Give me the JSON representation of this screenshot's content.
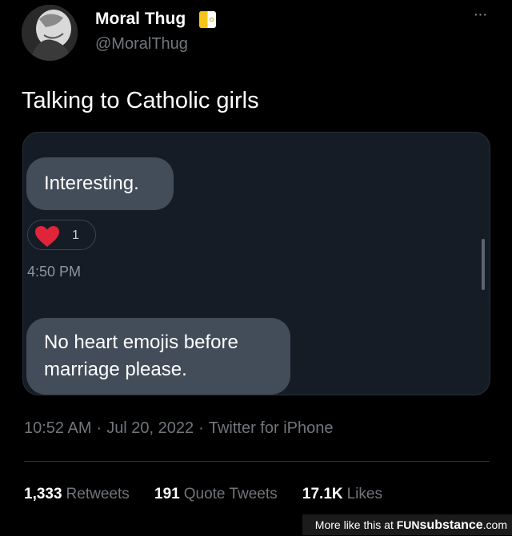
{
  "author": {
    "display_name": "Moral Thug",
    "handle": "@MoralThug",
    "badge_icon": "vatican-flag-icon",
    "avatar_icon": "avatar-image"
  },
  "more_label": "···",
  "tweet": {
    "text": "Talking to Catholic girls"
  },
  "media": {
    "bubble_1": "Interesting.",
    "reaction": {
      "icon": "red-heart-icon",
      "count": "1"
    },
    "time": "4:50 PM",
    "bubble_2_line_1": "No heart emojis before",
    "bubble_2_line_2": "marriage please."
  },
  "meta": {
    "time": "10:52 AM",
    "sep_1": "·",
    "date": "Jul 20, 2022",
    "sep_2": "·",
    "source": "Twitter for iPhone"
  },
  "stats": {
    "retweets_count": "1,333",
    "retweets_label": "Retweets",
    "quotes_count": "191",
    "quotes_label": "Quote Tweets",
    "likes_count": "17.1K",
    "likes_label": "Likes"
  },
  "footer": {
    "prefix": "More like this at ",
    "brand_a": "FUN",
    "brand_b": "substance",
    "suffix": ".com"
  },
  "colors": {
    "background": "#000000",
    "bubble": "#434c59",
    "media_bg": "#161c26",
    "heart": "#e0243a",
    "badge_yellow": "#f5c518"
  }
}
